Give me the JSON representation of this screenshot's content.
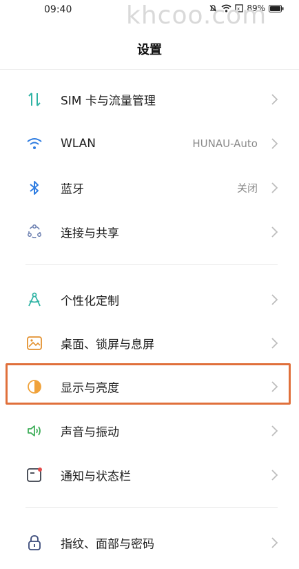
{
  "status_bar": {
    "time": "09:40",
    "battery": "89%"
  },
  "watermark": "khcoo.com",
  "page_title": "设置",
  "items": [
    {
      "label": "SIM 卡与流量管理",
      "value": "",
      "icon": "sim-data-icon"
    },
    {
      "label": "WLAN",
      "value": "HUNAU-Auto",
      "icon": "wifi-icon"
    },
    {
      "label": "蓝牙",
      "value": "关闭",
      "icon": "bluetooth-icon"
    },
    {
      "label": "连接与共享",
      "value": "",
      "icon": "connection-sharing-icon"
    },
    {
      "label": "个性化定制",
      "value": "",
      "icon": "personalization-icon"
    },
    {
      "label": "桌面、锁屏与息屏",
      "value": "",
      "icon": "wallpaper-icon"
    },
    {
      "label": "显示与亮度",
      "value": "",
      "icon": "display-brightness-icon"
    },
    {
      "label": "声音与振动",
      "value": "",
      "icon": "sound-icon"
    },
    {
      "label": "通知与状态栏",
      "value": "",
      "icon": "notification-icon"
    },
    {
      "label": "指纹、面部与密码",
      "value": "",
      "icon": "lock-icon"
    }
  ],
  "colors": {
    "highlight": "#e0703b",
    "teal": "#2fb3a4",
    "blue": "#2f7de1",
    "orange": "#f0a23a"
  }
}
